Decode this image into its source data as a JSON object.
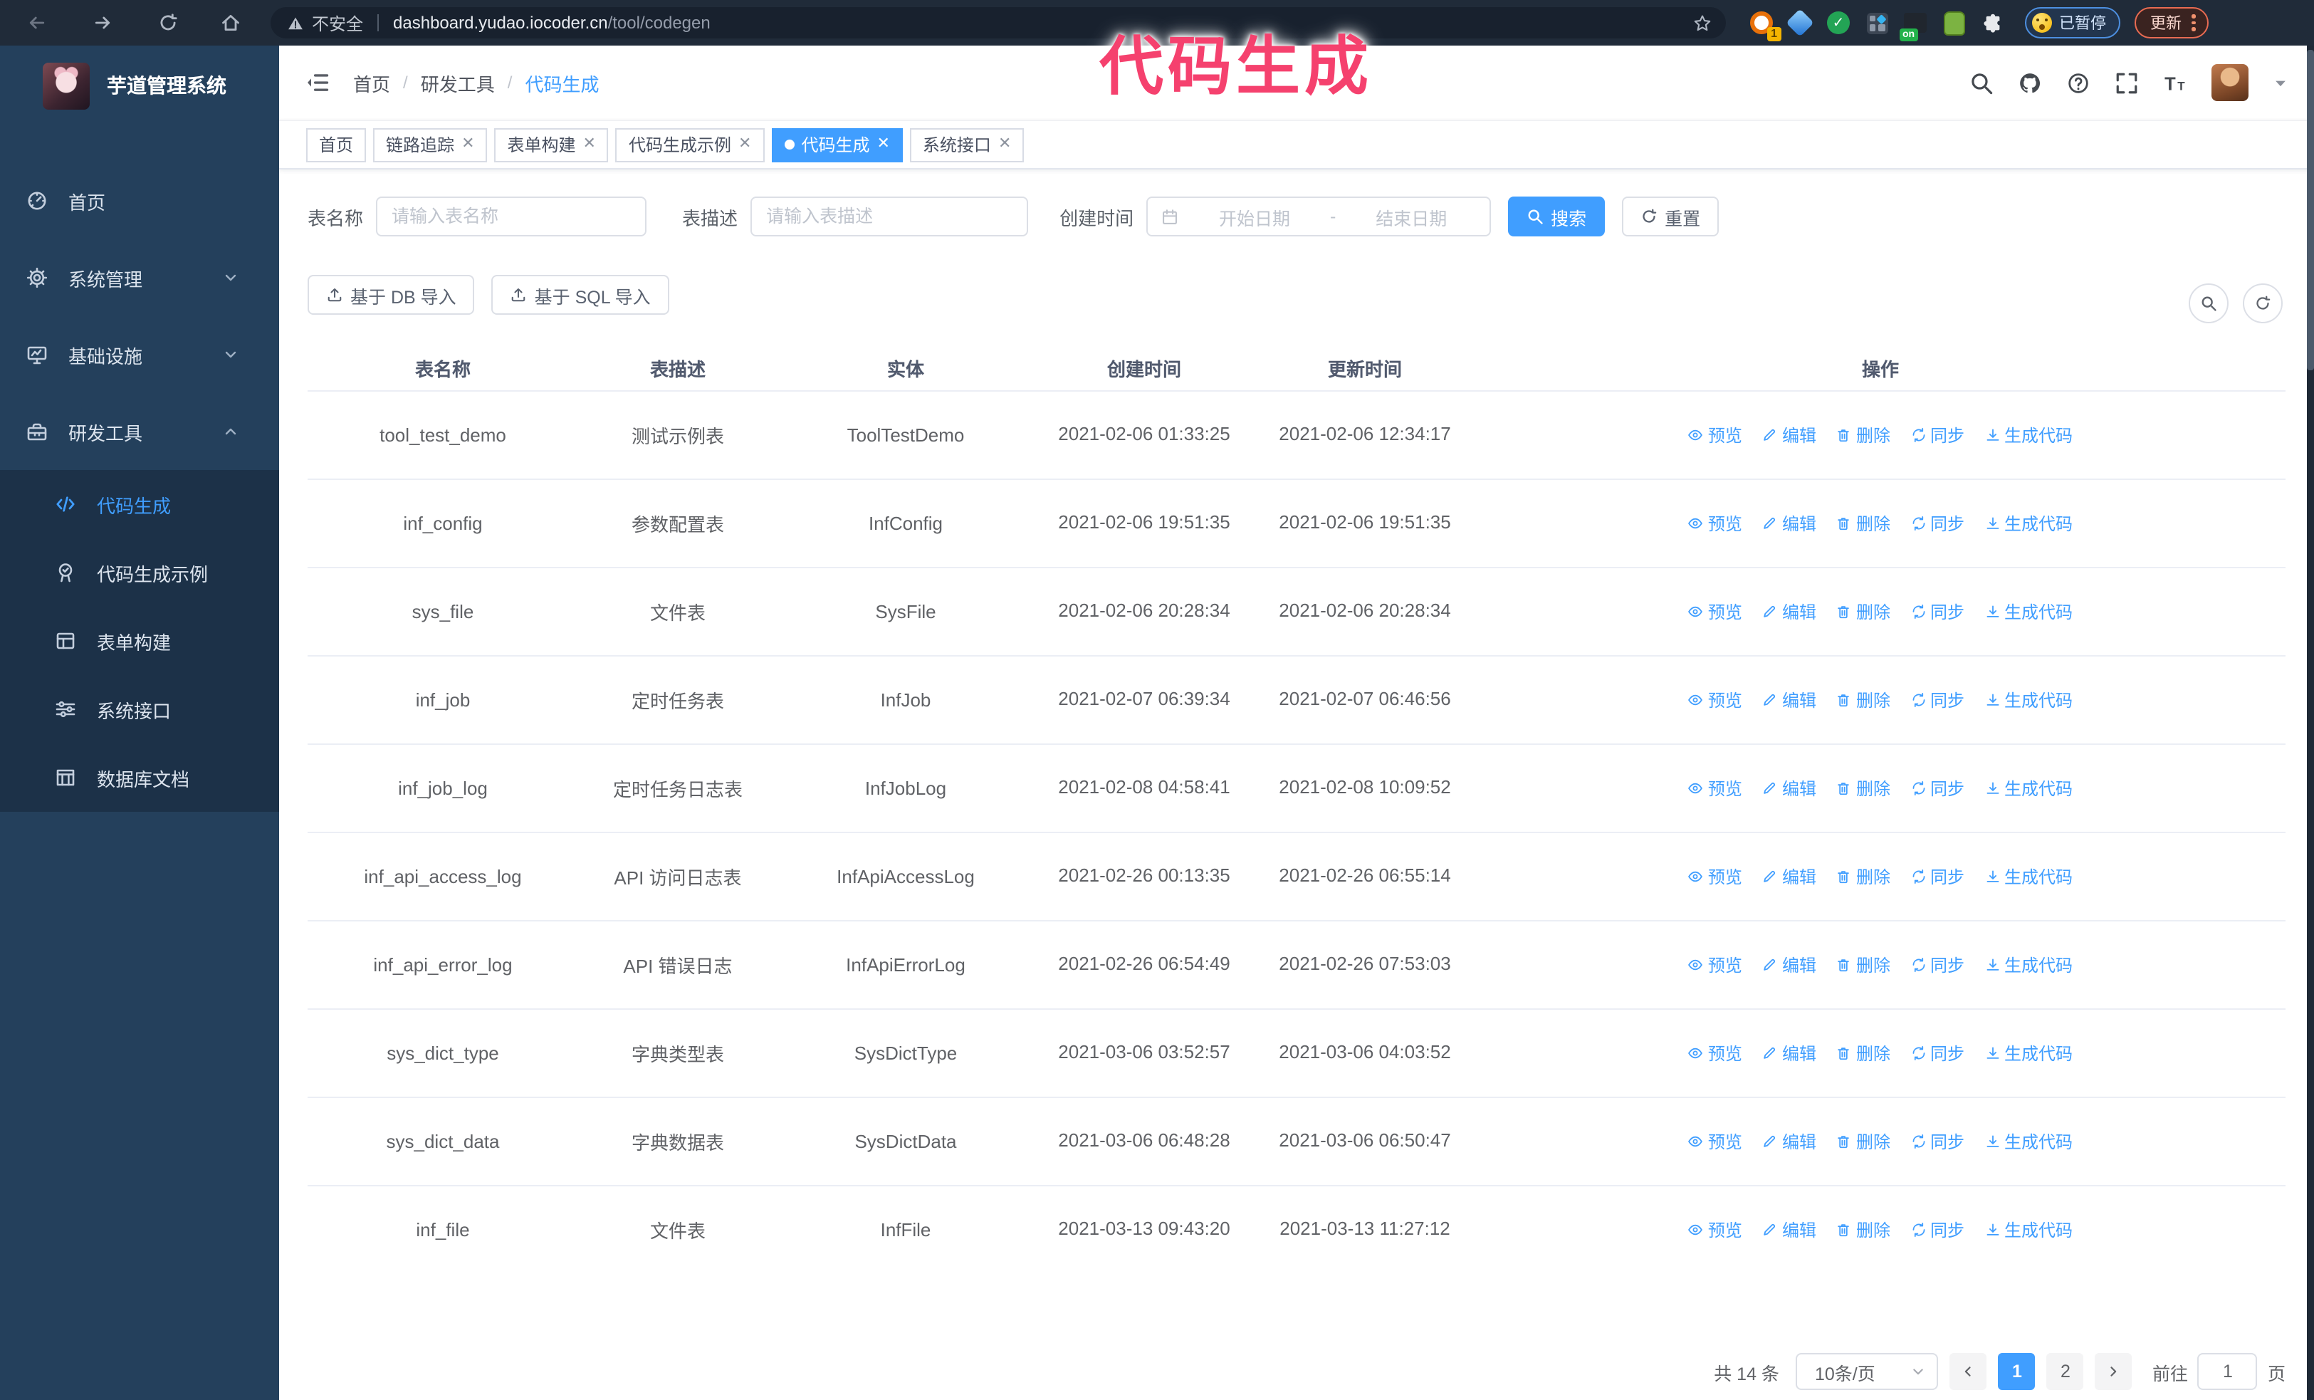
{
  "browser": {
    "security_warning": "不安全",
    "url_host": "dashboard.yudao.iocoder.cn",
    "url_path": "/tool/codegen",
    "paused_label": "已暂停",
    "update_label": "更新",
    "nav_icons": [
      "back-icon",
      "forward-icon",
      "reload-icon",
      "home-icon"
    ],
    "extensions": [
      {
        "name": "extension-orange-icon",
        "badge": "1"
      },
      {
        "name": "extension-gem-icon"
      },
      {
        "name": "extension-green-check-icon",
        "glyph": "✓"
      },
      {
        "name": "extension-grid-icon"
      },
      {
        "name": "extension-on-icon",
        "badge": "on"
      },
      {
        "name": "extension-green-icon"
      },
      {
        "name": "extension-puzzle-icon"
      }
    ]
  },
  "overlay": {
    "title": "代码生成",
    "color": "#f5416e"
  },
  "sidebar": {
    "app_title": "芋道管理系统",
    "items": [
      {
        "label": "首页",
        "icon": "dashboard-icon"
      },
      {
        "label": "系统管理",
        "icon": "gear-icon",
        "chevron": "down"
      },
      {
        "label": "基础设施",
        "icon": "monitor-icon",
        "chevron": "down"
      },
      {
        "label": "研发工具",
        "icon": "toolbox-icon",
        "chevron": "up",
        "expanded": true
      }
    ],
    "sub_items": [
      {
        "label": "代码生成",
        "icon": "code-icon",
        "active": true
      },
      {
        "label": "代码生成示例",
        "icon": "medal-icon"
      },
      {
        "label": "表单构建",
        "icon": "form-icon"
      },
      {
        "label": "系统接口",
        "icon": "sliders-icon"
      },
      {
        "label": "数据库文档",
        "icon": "database-doc-icon"
      }
    ]
  },
  "header": {
    "breadcrumb": [
      "首页",
      "研发工具",
      "代码生成"
    ],
    "right_icons": [
      "search-icon",
      "github-icon",
      "help-icon",
      "fullscreen-icon",
      "font-size-icon",
      "avatar",
      "caret-down-icon"
    ]
  },
  "tabs": [
    {
      "label": "首页",
      "closable": false
    },
    {
      "label": "链路追踪",
      "closable": true
    },
    {
      "label": "表单构建",
      "closable": true
    },
    {
      "label": "代码生成示例",
      "closable": true
    },
    {
      "label": "代码生成",
      "closable": true,
      "active": true
    },
    {
      "label": "系统接口",
      "closable": true
    }
  ],
  "filters": {
    "table_name_label": "表名称",
    "table_name_placeholder": "请输入表名称",
    "table_desc_label": "表描述",
    "table_desc_placeholder": "请输入表描述",
    "create_time_label": "创建时间",
    "start_placeholder": "开始日期",
    "range_separator": "-",
    "end_placeholder": "结束日期",
    "search_label": "搜索",
    "reset_label": "重置"
  },
  "toolbar": {
    "import_db_label": "基于 DB 导入",
    "import_sql_label": "基于 SQL 导入"
  },
  "table": {
    "columns": [
      "表名称",
      "表描述",
      "实体",
      "创建时间",
      "更新时间",
      "操作"
    ],
    "actions": [
      {
        "label": "预览",
        "icon": "eye-icon",
        "name": "preview"
      },
      {
        "label": "编辑",
        "icon": "pencil-icon",
        "name": "edit"
      },
      {
        "label": "删除",
        "icon": "trash-icon",
        "name": "delete"
      },
      {
        "label": "同步",
        "icon": "sync-icon",
        "name": "sync"
      },
      {
        "label": "生成代码",
        "icon": "download-icon",
        "name": "generate-code"
      }
    ],
    "rows": [
      {
        "name": "tool_test_demo",
        "desc": "测试示例表",
        "entity": "ToolTestDemo",
        "created": "2021-02-06 01:33:25",
        "updated": "2021-02-06 12:34:17"
      },
      {
        "name": "inf_config",
        "desc": "参数配置表",
        "entity": "InfConfig",
        "created": "2021-02-06 19:51:35",
        "updated": "2021-02-06 19:51:35"
      },
      {
        "name": "sys_file",
        "desc": "文件表",
        "entity": "SysFile",
        "created": "2021-02-06 20:28:34",
        "updated": "2021-02-06 20:28:34"
      },
      {
        "name": "inf_job",
        "desc": "定时任务表",
        "entity": "InfJob",
        "created": "2021-02-07 06:39:34",
        "updated": "2021-02-07 06:46:56"
      },
      {
        "name": "inf_job_log",
        "desc": "定时任务日志表",
        "entity": "InfJobLog",
        "created": "2021-02-08 04:58:41",
        "updated": "2021-02-08 10:09:52"
      },
      {
        "name": "inf_api_access_log",
        "desc": "API 访问日志表",
        "entity": "InfApiAccessLog",
        "created": "2021-02-26 00:13:35",
        "updated": "2021-02-26 06:55:14"
      },
      {
        "name": "inf_api_error_log",
        "desc": "API 错误日志",
        "entity": "InfApiErrorLog",
        "created": "2021-02-26 06:54:49",
        "updated": "2021-02-26 07:53:03"
      },
      {
        "name": "sys_dict_type",
        "desc": "字典类型表",
        "entity": "SysDictType",
        "created": "2021-03-06 03:52:57",
        "updated": "2021-03-06 04:03:52"
      },
      {
        "name": "sys_dict_data",
        "desc": "字典数据表",
        "entity": "SysDictData",
        "created": "2021-03-06 06:48:28",
        "updated": "2021-03-06 06:50:47"
      },
      {
        "name": "inf_file",
        "desc": "文件表",
        "entity": "InfFile",
        "created": "2021-03-13 09:43:20",
        "updated": "2021-03-13 11:27:12"
      }
    ]
  },
  "pagination": {
    "total": "共 14 条",
    "page_size": "10条/页",
    "pages": [
      {
        "label": "1",
        "active": true
      },
      {
        "label": "2",
        "active": false
      }
    ],
    "goto_label": "前往",
    "goto_value": "1",
    "page_suffix": "页"
  },
  "colors": {
    "accent": "#409EFF",
    "sidebar_bg": "#24405c",
    "submenu_bg": "#1c3148",
    "toolbar_bg": "#202b39",
    "annotation_pink": "#f5416e"
  }
}
